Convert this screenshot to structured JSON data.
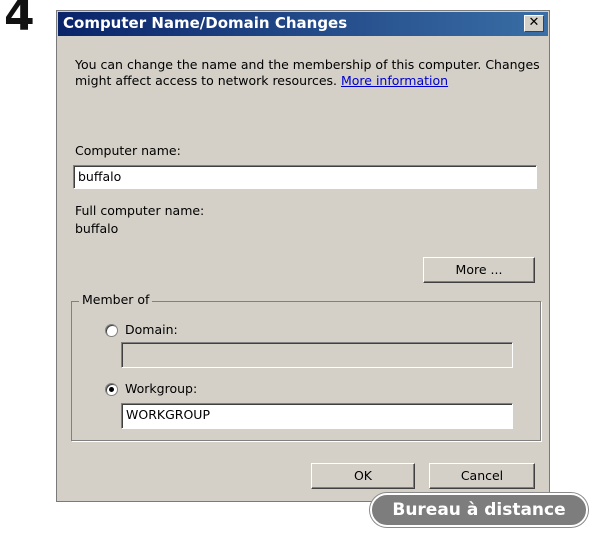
{
  "step_number": "4",
  "dialog": {
    "title": "Computer Name/Domain Changes",
    "close_glyph": "✕",
    "description_line": "You can change the name and the membership of this computer. Changes might affect access to network resources.",
    "more_info_link": "More information",
    "computer_name_label": "Computer name:",
    "computer_name_value": "buffalo",
    "full_name_label": "Full computer name:",
    "full_name_value": "buffalo",
    "more_button": "More ...",
    "member_of": {
      "label": "Member of",
      "domain_label": "Domain:",
      "domain_value": "",
      "workgroup_label": "Workgroup:",
      "workgroup_value": "WORKGROUP",
      "selected": "Workgroup"
    },
    "ok_button": "OK",
    "cancel_button": "Cancel"
  },
  "badge": "Bureau à distance"
}
